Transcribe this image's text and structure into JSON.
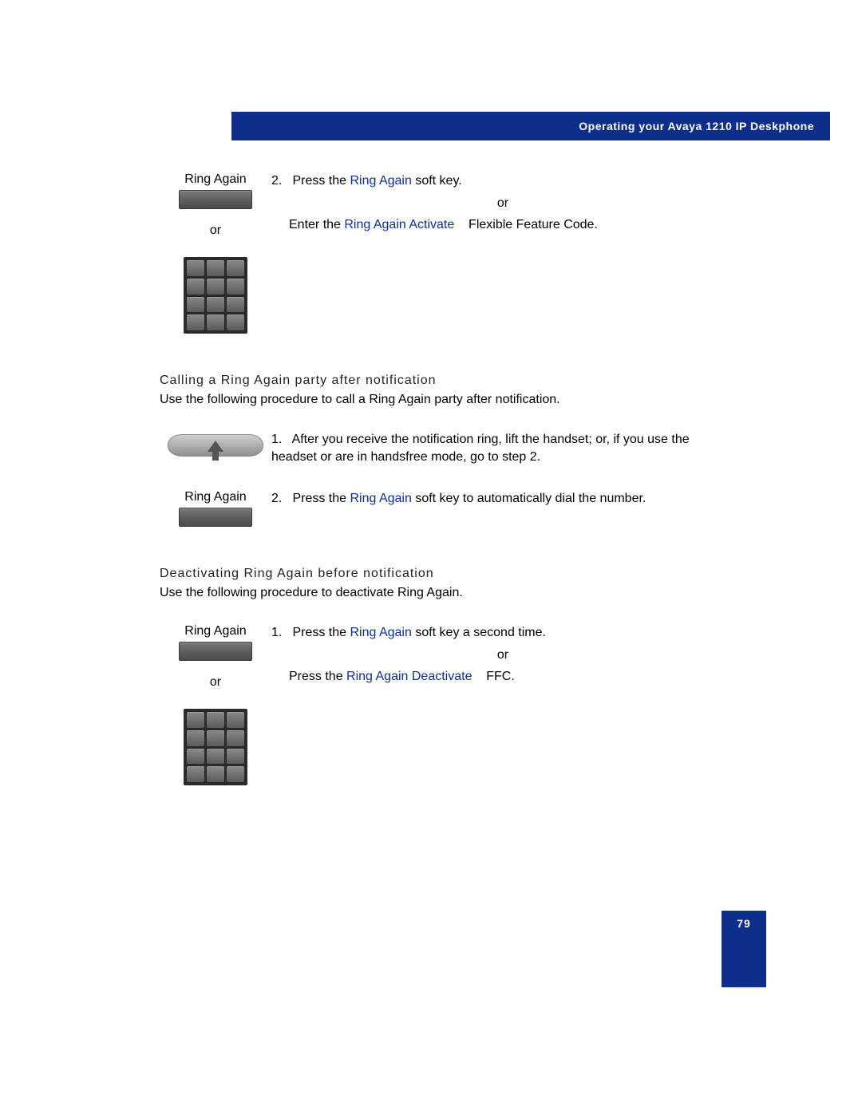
{
  "header": {
    "title": "Operating your Avaya 1210 IP Deskphone"
  },
  "section1": {
    "left_label": "Ring Again",
    "left_or": "or",
    "step_num": "2.",
    "step_pre": "Press the ",
    "step_blue": "Ring Again",
    "step_post": " soft key.",
    "or": "or",
    "alt_pre": "Enter the ",
    "alt_blue": "Ring Again Activate",
    "alt_post": " Flexible Feature Code."
  },
  "section2": {
    "heading": "Calling a Ring Again party after notification",
    "intro": "Use the following procedure to call a Ring Again party after notification.",
    "step1_num": "1.",
    "step1_text": "After you receive the notification ring, lift the handset; or, if you use the headset or are in handsfree mode, go to step 2.",
    "left_label": "Ring Again",
    "step2_num": "2.",
    "step2_pre": "Press the ",
    "step2_blue": "Ring Again",
    "step2_post": " soft key to automatically dial the number."
  },
  "section3": {
    "heading": "Deactivating Ring Again before notification",
    "intro": "Use the following procedure to deactivate Ring Again.",
    "left_label": "Ring Again",
    "left_or": "or",
    "step1_num": "1.",
    "step1_pre": "Press the ",
    "step1_blue": "Ring Again",
    "step1_post": " soft key a second time.",
    "or": "or",
    "alt_pre": "Press the ",
    "alt_blue": "Ring Again Deactivate",
    "alt_post": " FFC."
  },
  "page_number": "79"
}
